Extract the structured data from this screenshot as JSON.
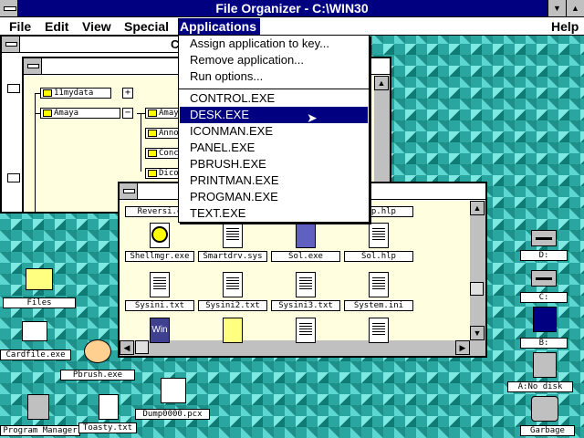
{
  "app": {
    "title": "File Organizer - C:\\WIN30"
  },
  "menubar": {
    "file": "File",
    "edit": "Edit",
    "view": "View",
    "special": "Special",
    "applications": "Applications",
    "help": "Help"
  },
  "tree_window": {
    "title_fragment": "C"
  },
  "tree": {
    "items": [
      "11mydata",
      "Amaya",
      "Amay",
      "Anno",
      "Conc",
      "Dico"
    ]
  },
  "dropdown": {
    "items": [
      "Assign application to key...",
      "Remove application...",
      "Run options..."
    ],
    "programs": [
      "CONTROL.EXE",
      "DESK.EXE",
      "ICONMAN.EXE",
      "PANEL.EXE",
      "PBRUSH.EXE",
      "PRINTMAN.EXE",
      "PROGMAN.EXE",
      "TEXT.EXE"
    ],
    "selected": "DESK.EXE"
  },
  "files": {
    "row0": [
      "Reversi.e",
      "",
      "",
      "tup.hlp"
    ],
    "row1": [
      "Shellmgr.exe",
      "Smartdrv.sys",
      "Sol.exe",
      "Sol.hlp"
    ],
    "row2": [
      "Sysini.txt",
      "Sysini2.txt",
      "Sysini3.txt",
      "System.ini"
    ]
  },
  "desktop": {
    "files": "Files",
    "cardfile": "Cardfile.exe",
    "pbrush": "Pbrush.exe",
    "program_manager": "Program Manager",
    "toasty": "Toasty.txt",
    "dump": "Dump0000.pcx",
    "drive_d": "D:",
    "drive_c": "C:",
    "drive_b": "B:",
    "drive_a": "A:No disk",
    "garbage": "Garbage"
  },
  "colors": {
    "titlebar": "#000080",
    "highlight": "#000080",
    "folder": "#ffff00",
    "window_bg": "#ffffe0"
  }
}
